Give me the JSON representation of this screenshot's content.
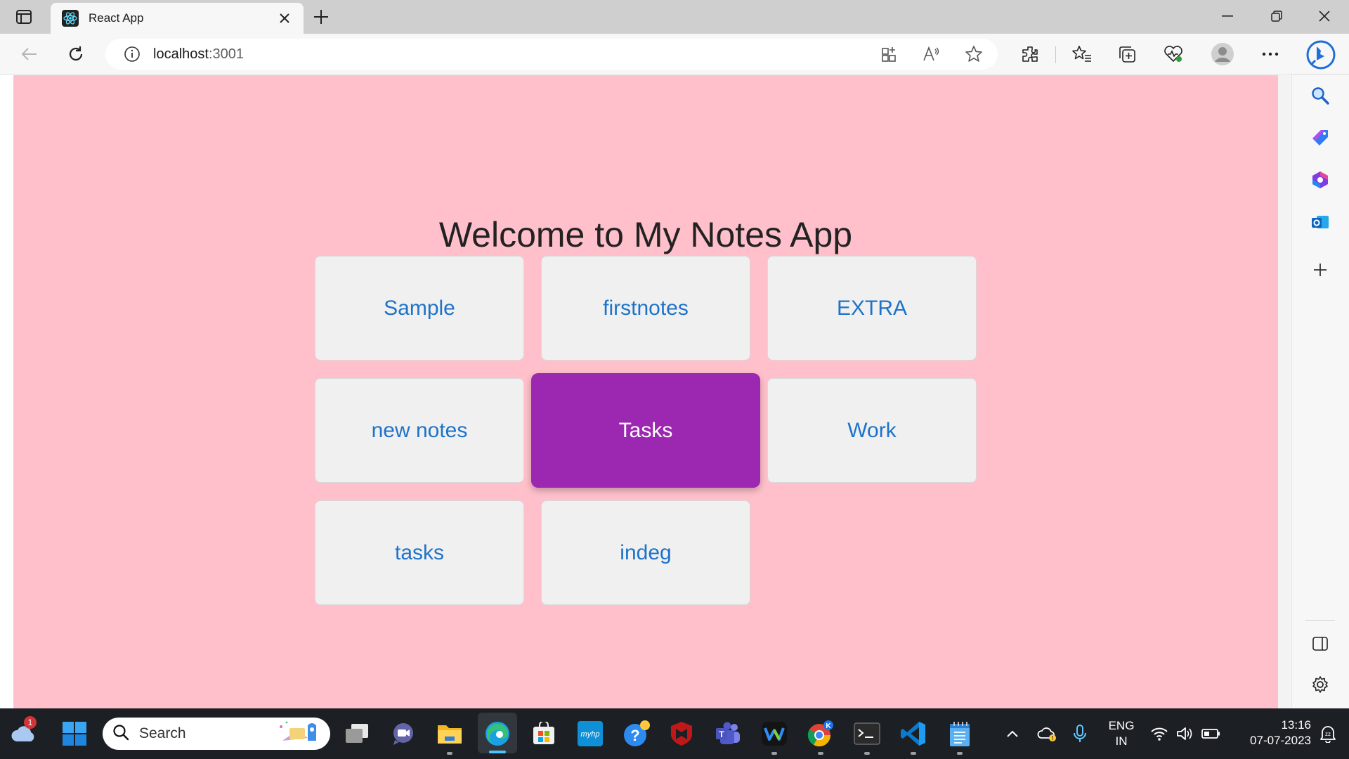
{
  "browser": {
    "tab_title": "React App",
    "url_host": "localhost",
    "url_port": ":3001",
    "icons": [
      "tab-actions-icon",
      "react-favicon",
      "close-icon",
      "plus-icon",
      "minimize-icon",
      "restore-icon",
      "close-window-icon",
      "back-icon",
      "refresh-icon",
      "info-icon",
      "app-available-icon",
      "read-aloud-icon",
      "favorite-star-icon",
      "extensions-icon",
      "favorites-icon",
      "collections-icon",
      "browser-essentials-icon",
      "profile-icon",
      "more-icon",
      "bing-icon"
    ]
  },
  "page": {
    "title": "Welcome to My Notes App",
    "background": "#ffc0cb",
    "active_color": "#9c27b0",
    "link_color": "#1e73c9",
    "cards": [
      {
        "label": "Sample"
      },
      {
        "label": "firstnotes"
      },
      {
        "label": "EXTRA"
      },
      {
        "label": "new notes"
      },
      {
        "label": "Tasks",
        "active": true
      },
      {
        "label": "Work"
      },
      {
        "label": "tasks"
      },
      {
        "label": "indeg"
      }
    ]
  },
  "sidebar": {
    "icons": [
      "search-icon",
      "shopping-tag-icon",
      "office-icon",
      "outlook-icon",
      "add-icon",
      "sidebar-toggle-icon",
      "settings-icon"
    ]
  },
  "taskbar": {
    "weather_badge": "1",
    "search_label": "Search",
    "lang_line1": "ENG",
    "lang_line2": "IN",
    "time": "13:16",
    "date": "07-07-2023",
    "apps": [
      "start-icon",
      "task-view-icon",
      "chat-icon",
      "file-explorer-icon",
      "edge-icon",
      "store-icon",
      "myhp-icon",
      "help-icon",
      "mcafee-icon",
      "teams-icon",
      "webex-icon",
      "chrome-icon",
      "terminal-icon",
      "vscode-icon",
      "notepad-icon"
    ]
  }
}
